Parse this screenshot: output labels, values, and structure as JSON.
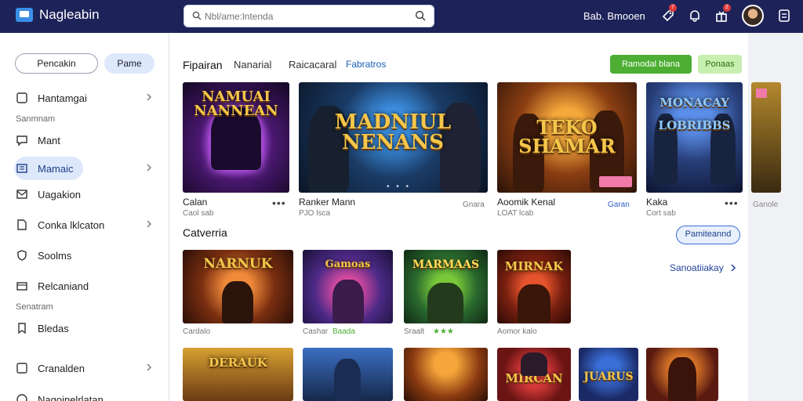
{
  "header": {
    "brand": "Nagleabin",
    "search_placeholder": "Nbl/ame:lntenda",
    "link": "Bab. Bmooen",
    "badges": [
      "7",
      "2"
    ]
  },
  "sidebar": {
    "pill_primary": "Pencakin",
    "pill_secondary": "Pame",
    "items": [
      {
        "label": "Hantamgai",
        "icon": "square-icon",
        "chevron": true
      },
      {
        "label": "Mant",
        "icon": "chat-icon",
        "chevron": false
      },
      {
        "label": "Mamaic",
        "icon": "list-icon",
        "chevron": true,
        "active": true
      },
      {
        "label": "Uagakion",
        "icon": "mail-icon",
        "chevron": false
      },
      {
        "label": "Conka lklcaton",
        "icon": "doc-icon",
        "chevron": true
      },
      {
        "label": "Soolms",
        "icon": "shield-icon",
        "chevron": false
      },
      {
        "label": "Relcaniand",
        "icon": "box-icon",
        "chevron": false
      },
      {
        "label": "Bledas",
        "icon": "bookmark-icon",
        "chevron": false
      },
      {
        "label": "Cranalden",
        "icon": "frame-icon",
        "chevron": true
      },
      {
        "label": "Nagoinelrlatan",
        "icon": "circle-icon",
        "chevron": false
      }
    ],
    "sections": [
      "Sanmnam",
      "Senatram"
    ]
  },
  "main": {
    "tabs": [
      "Fipairan",
      "Nanarial",
      "Raicacaral",
      "Fabratros"
    ],
    "buttons": {
      "primary": "Ramodal blana",
      "secondary": "Ponaas"
    },
    "featured": [
      {
        "art_title": "NAMUAI\nNANNEAN",
        "name": "Calan",
        "sub": "Caol sab",
        "extra": "•••"
      },
      {
        "art_title": "MADNIUL\nNENANS",
        "name": "Ranker Mann",
        "sub": "PJO lsca",
        "extra": "Gnara"
      },
      {
        "art_title": "TEKO\nSHAMAR",
        "name": "Aoomik Kenal",
        "sub": "LOAT lcab",
        "extra": "Garan"
      },
      {
        "art_title": "MONACAY\nLOBRIBBS",
        "name": "Kaka",
        "sub": "Cort sab",
        "extra": "•••"
      }
    ],
    "peek_label": "Ganole",
    "section_title": "Catverria",
    "section_button": "Pamiteannd",
    "see_all": "Sanoatiiakay",
    "grid_row1": [
      {
        "art_title": "NARNUK",
        "name": "Cardalo",
        "tag": ""
      },
      {
        "art_title": "Gamoas",
        "name": "Cashar",
        "tag": "Baada"
      },
      {
        "art_title": "MARMAAS",
        "name": "Sraalt",
        "tag": "★★★"
      },
      {
        "art_title": "MIRNAK",
        "name": "Aomor kalo",
        "tag": ""
      }
    ],
    "grid_row2": [
      {
        "art_title": "DERAUK"
      },
      {
        "art_title": ""
      },
      {
        "art_title": ""
      },
      {
        "art_title": "MIRCAN"
      },
      {
        "art_title": "JUARUS"
      },
      {
        "art_title": ""
      }
    ]
  },
  "colors": {
    "topbar": "#1d2359",
    "accent_green": "#4cae32",
    "accent_blue": "#3a6fd8",
    "active_item": "#dde8fb"
  }
}
